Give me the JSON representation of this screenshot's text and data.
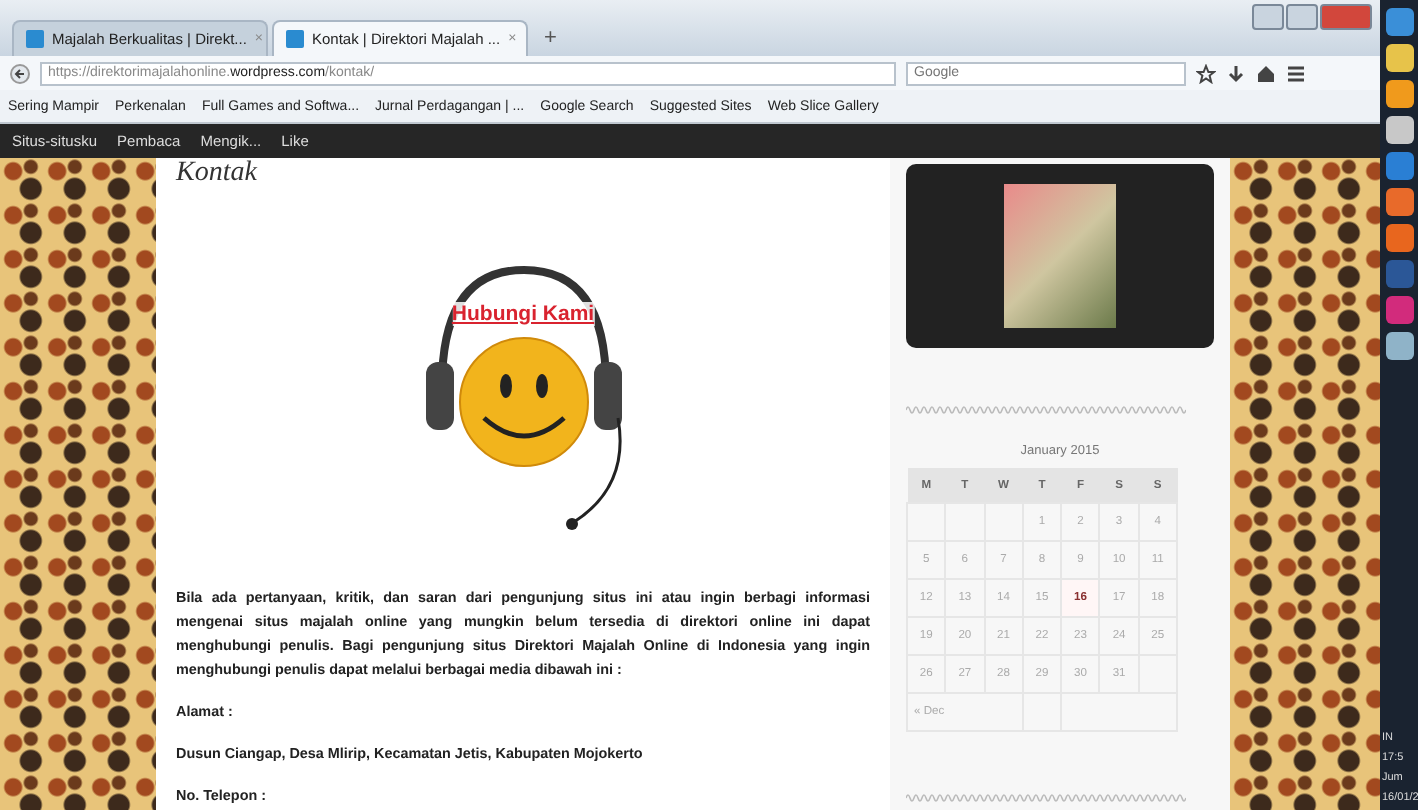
{
  "browser": {
    "tabs": [
      {
        "title": "Majalah Berkualitas | Direkt...",
        "close": "×",
        "selected": false
      },
      {
        "title": "Kontak | Direktori Majalah ...",
        "close": "×",
        "selected": true
      }
    ],
    "new_tab": "+",
    "url_prefix": "https://direktorimajalahonline.",
    "url_domain": "wordpress.com",
    "url_path": "/kontak/",
    "search_placeholder": "Google",
    "bookmarks": [
      "Sering Mampir",
      "Perkenalan",
      "Full Games and Softwa...",
      "Jurnal Perdagangan | ...",
      "Google Search",
      "Suggested Sites",
      "Web Slice Gallery"
    ]
  },
  "admin_bar": {
    "items": [
      "Situs-situsku",
      "Pembaca",
      "Mengik...",
      "Like"
    ]
  },
  "page": {
    "title": "Kontak",
    "image_caption": "Hubungi Kami",
    "paragraphs": [
      {
        "kind": "body",
        "text": "Bila ada pertanyaan, kritik, dan saran dari pengunjung situs ini atau ingin berbagi informasi mengenai situs majalah online yang mungkin belum tersedia di direktori online ini dapat menghubungi penulis. Bagi pengunjung situs Direktori Majalah Online di Indonesia yang ingin menghubungi penulis dapat melalui berbagai media dibawah ini :"
      },
      {
        "kind": "body",
        "text": "Alamat :"
      },
      {
        "kind": "body",
        "text": "Dusun Ciangap, Desa Mlirip, Kecamatan Jetis, Kabupaten Mojokerto"
      },
      {
        "kind": "body",
        "text": "No. Telepon :"
      }
    ]
  },
  "calendar": {
    "caption": "January 2015",
    "headers": [
      "M",
      "T",
      "W",
      "T",
      "F",
      "S",
      "S"
    ],
    "weeks": [
      [
        {
          "day": "1",
          "today": false
        },
        {
          "day": "2",
          "today": false
        },
        {
          "day": "3",
          "today": false
        },
        {
          "day": "4",
          "today": false
        }
      ],
      [
        {
          "day": "5",
          "today": false
        },
        {
          "day": "6",
          "today": false
        },
        {
          "day": "7",
          "today": false
        },
        {
          "day": "8",
          "today": false
        },
        {
          "day": "9",
          "today": false
        },
        {
          "day": "10",
          "today": false
        },
        {
          "day": "11",
          "today": false
        }
      ],
      [
        {
          "day": "12",
          "today": false
        },
        {
          "day": "13",
          "today": false
        },
        {
          "day": "14",
          "today": false
        },
        {
          "day": "15",
          "today": false
        },
        {
          "day": "16",
          "today": true
        },
        {
          "day": "17",
          "today": false
        },
        {
          "day": "18",
          "today": false
        }
      ],
      [
        {
          "day": "19",
          "today": false
        },
        {
          "day": "20",
          "today": false
        },
        {
          "day": "21",
          "today": false
        },
        {
          "day": "22",
          "today": false
        },
        {
          "day": "23",
          "today": false
        },
        {
          "day": "24",
          "today": false
        },
        {
          "day": "25",
          "today": false
        }
      ],
      [
        {
          "day": "26",
          "today": false
        },
        {
          "day": "27",
          "today": false
        },
        {
          "day": "28",
          "today": false
        },
        {
          "day": "29",
          "today": false
        },
        {
          "day": "30",
          "today": false
        },
        {
          "day": "31",
          "today": false
        }
      ]
    ],
    "prev": "« Dec"
  },
  "taskbar": {
    "apps": [
      {
        "color": "#3a8fd8"
      },
      {
        "color": "#e7c34a"
      },
      {
        "color": "#f09a1c"
      },
      {
        "color": "#c8c8c8"
      },
      {
        "color": "#2a7fd4"
      },
      {
        "color": "#e86a2a"
      },
      {
        "color": "#e8661e"
      },
      {
        "color": "#2b5797"
      },
      {
        "color": "#d22b7c"
      },
      {
        "color": "#8fb3c8"
      }
    ],
    "language": "IN",
    "time": "17:5",
    "day": "Jum",
    "date": "16/01/2"
  }
}
